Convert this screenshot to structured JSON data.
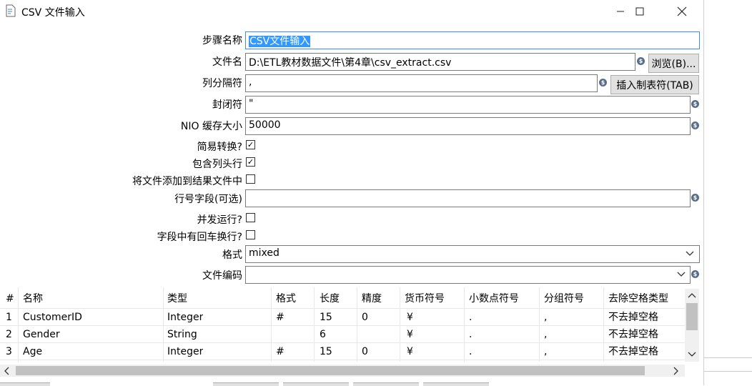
{
  "window": {
    "title": "CSV 文件输入",
    "minimize": "—",
    "maximize": "☐",
    "close": "✕"
  },
  "form": {
    "step_name_label": "步骤名称",
    "step_name_value": "CSV文件输入",
    "filename_label": "文件名",
    "filename_value": "D:\\ETL教材数据文件\\第4章\\csv_extract.csv",
    "browse_label": "浏览(B)...",
    "delimiter_label": "列分隔符",
    "delimiter_value": ",",
    "insert_tab_label": "插入制表符(TAB)",
    "enclosure_label": "封闭符",
    "enclosure_value": "\"",
    "nio_label": "NIO 缓存大小",
    "nio_value": "50000",
    "lazy_label": "简易转换?",
    "lazy_checked": true,
    "header_label": "包含列头行",
    "header_checked": true,
    "add_result_label": "将文件添加到结果文件中",
    "add_result_checked": false,
    "rownum_label": "行号字段(可选)",
    "rownum_value": "",
    "parallel_label": "并发运行?",
    "parallel_checked": false,
    "newline_label": "字段中有回车换行?",
    "newline_checked": false,
    "format_label": "格式",
    "format_value": "mixed",
    "encoding_label": "文件编码",
    "encoding_value": ""
  },
  "table": {
    "headers": [
      "#",
      "名称",
      "类型",
      "格式",
      "长度",
      "精度",
      "货币符号",
      "小数点符号",
      "分组符号",
      "去除空格类型"
    ],
    "rows": [
      [
        "1",
        "CustomerID",
        "Integer",
        "#",
        "15",
        "0",
        "¥",
        ".",
        ",",
        "不去掉空格"
      ],
      [
        "2",
        "Gender",
        "String",
        "",
        "6",
        "",
        "¥",
        ".",
        ",",
        "不去掉空格"
      ],
      [
        "3",
        "Age",
        "Integer",
        "#",
        "15",
        "0",
        "¥",
        ".",
        ",",
        "不去掉空格"
      ]
    ]
  },
  "icons": {
    "var": "$",
    "check": "✓",
    "dropdown": "⌄",
    "up": "︿",
    "down": "﹀",
    "left": "<",
    "right": ">"
  }
}
